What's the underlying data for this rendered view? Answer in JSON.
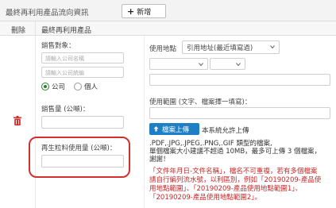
{
  "header": {
    "title": "最終再利用產品流向資訊",
    "add_button": "新增"
  },
  "table": {
    "col_delete": "刪除",
    "col_product": "最終再利用產品"
  },
  "sales_target": {
    "label": "銷售對象：",
    "company_name_placeholder": "請輸入公司名稱",
    "company_id_placeholder": "請輸入公司統編",
    "radio_company": "公司",
    "radio_person": "個人"
  },
  "sales_amount": {
    "label": "銷售量 (公噸)："
  },
  "recycled_usage": {
    "label": "再生粒料使用量 (公噸)："
  },
  "location": {
    "label": "使用地點",
    "select_value": "引用地址(最近填寫過)"
  },
  "scope": {
    "label": "使用範圍 (文字、檔案擇一填寫)："
  },
  "upload": {
    "button": "檔案上傳",
    "note": "本系統允許上傳",
    "types": ".PDF,.JPG,.JPEG,.PNG,.GIF 類型的檔案,",
    "size_line1": "單個檔案大小建議不超過 10MB，最多可上傳 3 個檔案，",
    "size_line2": "謝謝！",
    "red_line1": "「文件年月日-文件名稱」，檔名不可重複，若有多個檔案",
    "red_line2": "請自行編列流水號，以利區別，例如「20190209-產品使",
    "red_line3": "用地點範圍」、「20190209-產品使用地點範圍1」、",
    "red_line4": "「20190209-產品使用地點範圍2」。"
  },
  "colors": {
    "accent_blue": "#1f7fc4",
    "highlight_red": "#d32f2f",
    "note_red": "#c62828",
    "radio_green": "#2e7d32"
  },
  "icons": {
    "add": "plus-icon",
    "delete": "trash-icon",
    "upload": "upload-icon",
    "dropdown": "chevron-down-icon"
  }
}
